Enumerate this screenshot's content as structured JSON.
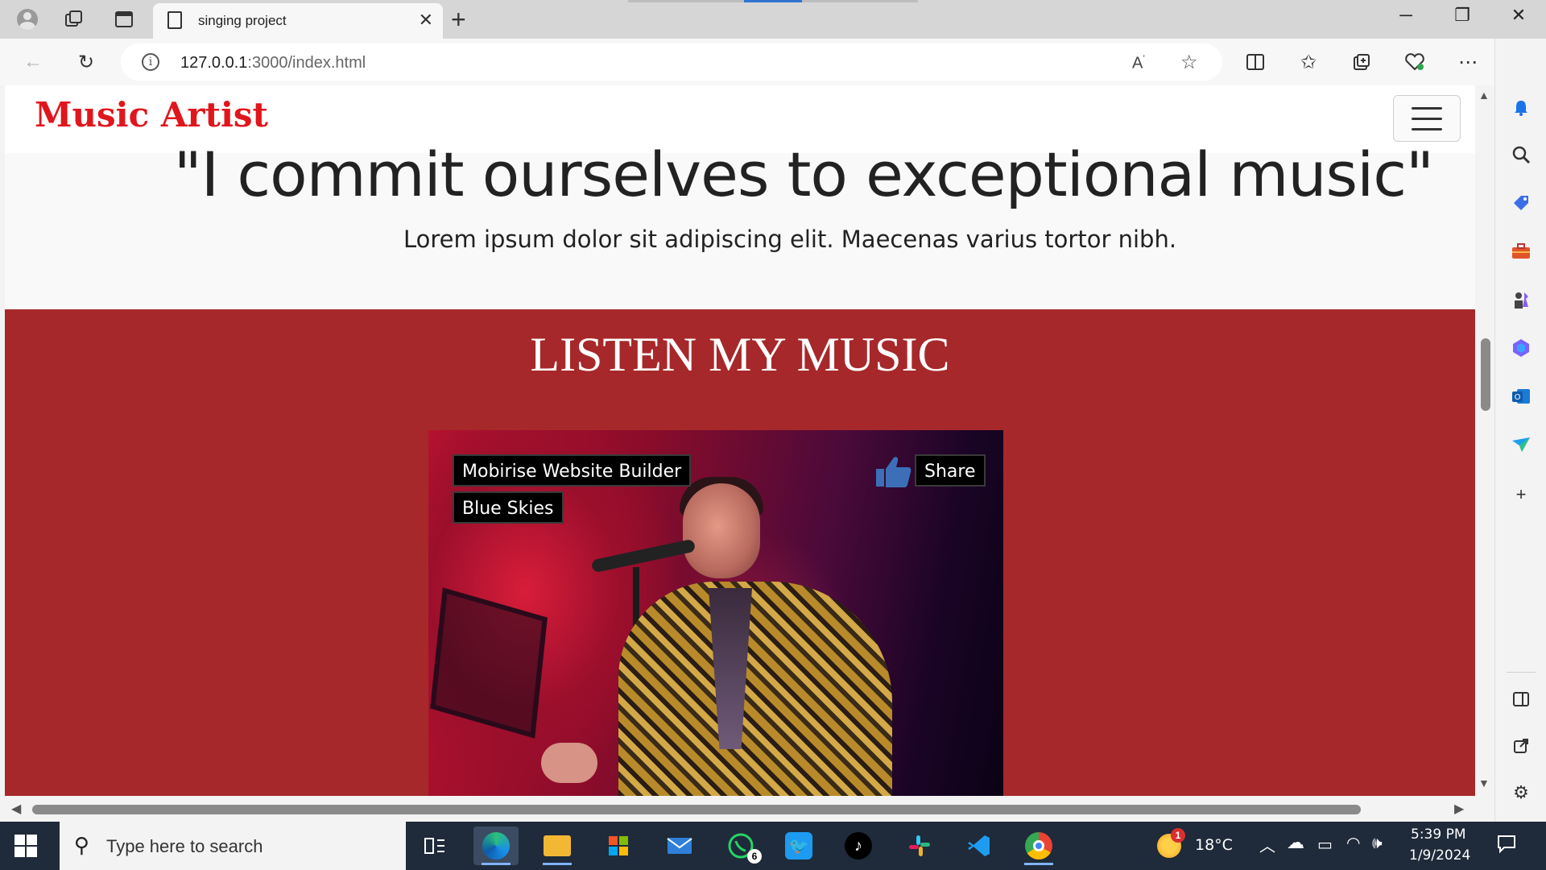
{
  "browser": {
    "tab_title": "singing project",
    "url_host": "127.0.0.1",
    "url_path": ":3000/index.html"
  },
  "page": {
    "brand": "Music Artist",
    "hero_quote": "\"I commit ourselves to exceptional music\"",
    "hero_subtitle": "Lorem ipsum dolor sit adipiscing elit. Maecenas varius tortor nibh.",
    "music_heading": "LISTEN MY MUSIC",
    "video": {
      "channel": "Mobirise Website Builder",
      "title": "Blue Skies",
      "share_label": "Share"
    }
  },
  "taskbar": {
    "search_placeholder": "Type here to search",
    "whatsapp_badge": "6",
    "weather_badge": "1",
    "temperature": "18°C",
    "time": "5:39 PM",
    "date": "1/9/2024"
  },
  "colors": {
    "brand": "#e0161d",
    "section_bg": "#a7282a",
    "taskbar_bg": "#1f2a3a"
  },
  "icons": {
    "sidebar": [
      "bell-icon",
      "search-icon",
      "tag-icon",
      "toolbox-icon",
      "chess-icon",
      "copilot-icon",
      "outlook-icon",
      "send-icon",
      "plus-icon",
      "split-panel-icon",
      "external-link-icon",
      "settings-icon"
    ]
  }
}
